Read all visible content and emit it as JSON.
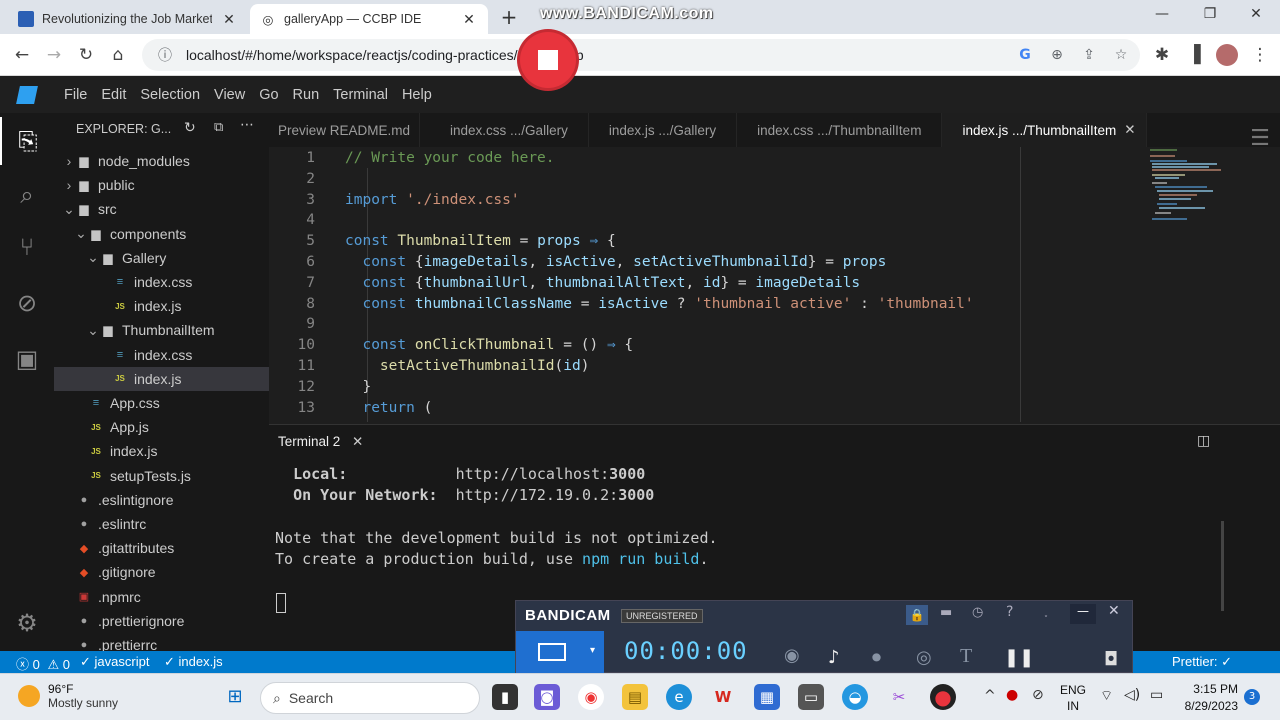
{
  "browser": {
    "tabs": [
      {
        "title": "Revolutionizing the Job Market | N",
        "active": false
      },
      {
        "title": "galleryApp — CCBP IDE",
        "active": true
      }
    ],
    "url": "localhost/#/home/workspace/reactjs/coding-practices/galleryApp"
  },
  "watermark": "www.BANDICAM.com",
  "menu": [
    "File",
    "Edit",
    "Selection",
    "View",
    "Go",
    "Run",
    "Terminal",
    "Help"
  ],
  "explorer": {
    "title": "EXPLORER: G...",
    "items": [
      {
        "label": "node_modules",
        "type": "folder",
        "open": false,
        "depth": 0
      },
      {
        "label": "public",
        "type": "folder",
        "open": false,
        "depth": 0
      },
      {
        "label": "src",
        "type": "folder",
        "open": true,
        "depth": 0
      },
      {
        "label": "components",
        "type": "folder",
        "open": true,
        "depth": 1
      },
      {
        "label": "Gallery",
        "type": "folder",
        "open": true,
        "depth": 2
      },
      {
        "label": "index.css",
        "type": "css",
        "depth": 3
      },
      {
        "label": "index.js",
        "type": "js",
        "depth": 3
      },
      {
        "label": "ThumbnailItem",
        "type": "folder",
        "open": true,
        "depth": 2
      },
      {
        "label": "index.css",
        "type": "css",
        "depth": 3
      },
      {
        "label": "index.js",
        "type": "js",
        "depth": 3,
        "selected": true
      },
      {
        "label": "App.css",
        "type": "css",
        "depth": 1
      },
      {
        "label": "App.js",
        "type": "js",
        "depth": 1
      },
      {
        "label": "index.js",
        "type": "js",
        "depth": 1
      },
      {
        "label": "setupTests.js",
        "type": "js",
        "depth": 1
      },
      {
        "label": ".eslintignore",
        "type": "cfg",
        "depth": 0
      },
      {
        "label": ".eslintrc",
        "type": "cfg",
        "depth": 0
      },
      {
        "label": ".gitattributes",
        "type": "git",
        "depth": 0
      },
      {
        "label": ".gitignore",
        "type": "git",
        "depth": 0
      },
      {
        "label": ".npmrc",
        "type": "npm",
        "depth": 0
      },
      {
        "label": ".prettierignore",
        "type": "cfg",
        "depth": 0
      },
      {
        "label": ".prettierrc",
        "type": "cfg",
        "depth": 0
      }
    ]
  },
  "editor_tabs": [
    {
      "label": "Preview README.md",
      "active": false
    },
    {
      "label": "index.css .../Gallery",
      "active": false
    },
    {
      "label": "index.js .../Gallery",
      "active": false
    },
    {
      "label": "index.css .../ThumbnailItem",
      "active": false
    },
    {
      "label": "index.js .../ThumbnailItem",
      "active": true
    }
  ],
  "code_lines": [
    "// Write your code here.",
    "",
    "import './index.css'",
    "",
    "const ThumbnailItem = props ⇒ {",
    "  const {imageDetails, isActive, setActiveThumbnailId} = props",
    "  const {thumbnailUrl, thumbnailAltText, id} = imageDetails",
    "  const thumbnailClassName = isActive ? 'thumbnail active' : 'thumbnail'",
    "",
    "  const onClickThumbnail = () ⇒ {",
    "    setActiveThumbnailId(id)",
    "  }",
    "  return ("
  ],
  "line_numbers": [
    "1",
    "2",
    "3",
    "4",
    "5",
    "6",
    "7",
    "8",
    "9",
    "10",
    "11",
    "12",
    "13"
  ],
  "terminal": {
    "tab": "Terminal 2",
    "lines": [
      {
        "label": "Local:",
        "value": "http://localhost:",
        "port": "3000"
      },
      {
        "label": "On Your Network:",
        "value": "http://172.19.0.2:",
        "port": "3000"
      }
    ],
    "note1": "Note that the development build is not optimized.",
    "note2_prefix": "To create a production build, use ",
    "note2_cmd": "npm run build",
    "note2_suffix": "."
  },
  "status": {
    "errors": "0",
    "warnings": "0",
    "lang": "javascript",
    "file": "index.js",
    "prettier": "Prettier: ✓"
  },
  "bandicam": {
    "logo": "BANDICAM",
    "unregistered": "UNREGISTERED",
    "timer": "00:00:00"
  },
  "taskbar": {
    "temp": "96°F",
    "weather": "Mostly sunny",
    "search": "Search",
    "lang1": "ENG",
    "lang2": "IN",
    "time": "3:15 PM",
    "date": "8/29/2023",
    "notifications": "3"
  }
}
